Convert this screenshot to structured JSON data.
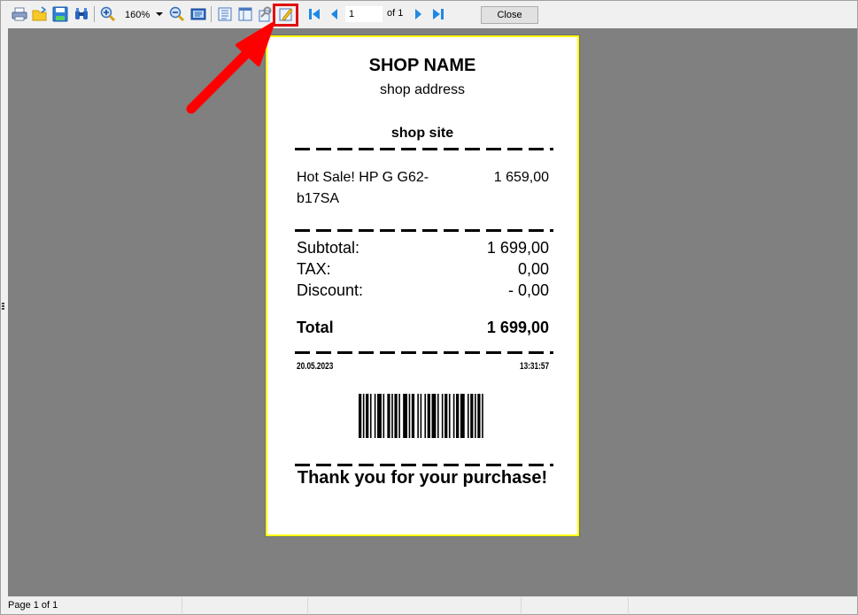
{
  "toolbar": {
    "buttons": [
      {
        "name": "print",
        "icon": "printer-icon"
      },
      {
        "name": "open",
        "icon": "open-folder-icon"
      },
      {
        "name": "save",
        "icon": "floppy-disk-icon"
      },
      {
        "name": "find",
        "icon": "binoculars-icon"
      },
      {
        "name": "zoom-in",
        "icon": "zoom-in-icon"
      },
      {
        "name": "zoom-out",
        "icon": "zoom-out-icon"
      },
      {
        "name": "full-screen",
        "icon": "monitor-icon"
      },
      {
        "name": "outline",
        "icon": "outline-icon"
      },
      {
        "name": "thumbnails",
        "icon": "thumbnails-icon"
      },
      {
        "name": "page-setup",
        "icon": "page-setup-icon"
      },
      {
        "name": "edit",
        "icon": "pencil-edit-icon"
      },
      {
        "name": "first-page",
        "icon": "first-page-icon"
      },
      {
        "name": "prev-page",
        "icon": "prev-page-icon"
      },
      {
        "name": "next-page",
        "icon": "next-page-icon"
      },
      {
        "name": "last-page",
        "icon": "last-page-icon"
      }
    ],
    "zoom_value": "160%",
    "page_input": "1",
    "page_of": "of 1",
    "close_label": "Close",
    "highlight_color": "#e01010"
  },
  "receipt": {
    "shop_name": "SHOP NAME",
    "shop_address": "shop address",
    "shop_site": "shop site",
    "items": [
      {
        "name": "Hot Sale! HP G G62-b17SA",
        "price": "1 659,00"
      }
    ],
    "subtotal_label": "Subtotal:",
    "subtotal_value": "1 699,00",
    "tax_label": "TAX:",
    "tax_value": "0,00",
    "discount_label": "Discount:",
    "discount_value": "- 0,00",
    "total_label": "Total",
    "total_value": "1 699,00",
    "date": "20.05.2023",
    "time": "13:31:57",
    "thanks": "Thank you for your purchase!",
    "border_color": "#ffff00"
  },
  "status": {
    "page_text": "Page 1 of 1"
  },
  "annotation": {
    "arrow_color": "#ff0000"
  }
}
